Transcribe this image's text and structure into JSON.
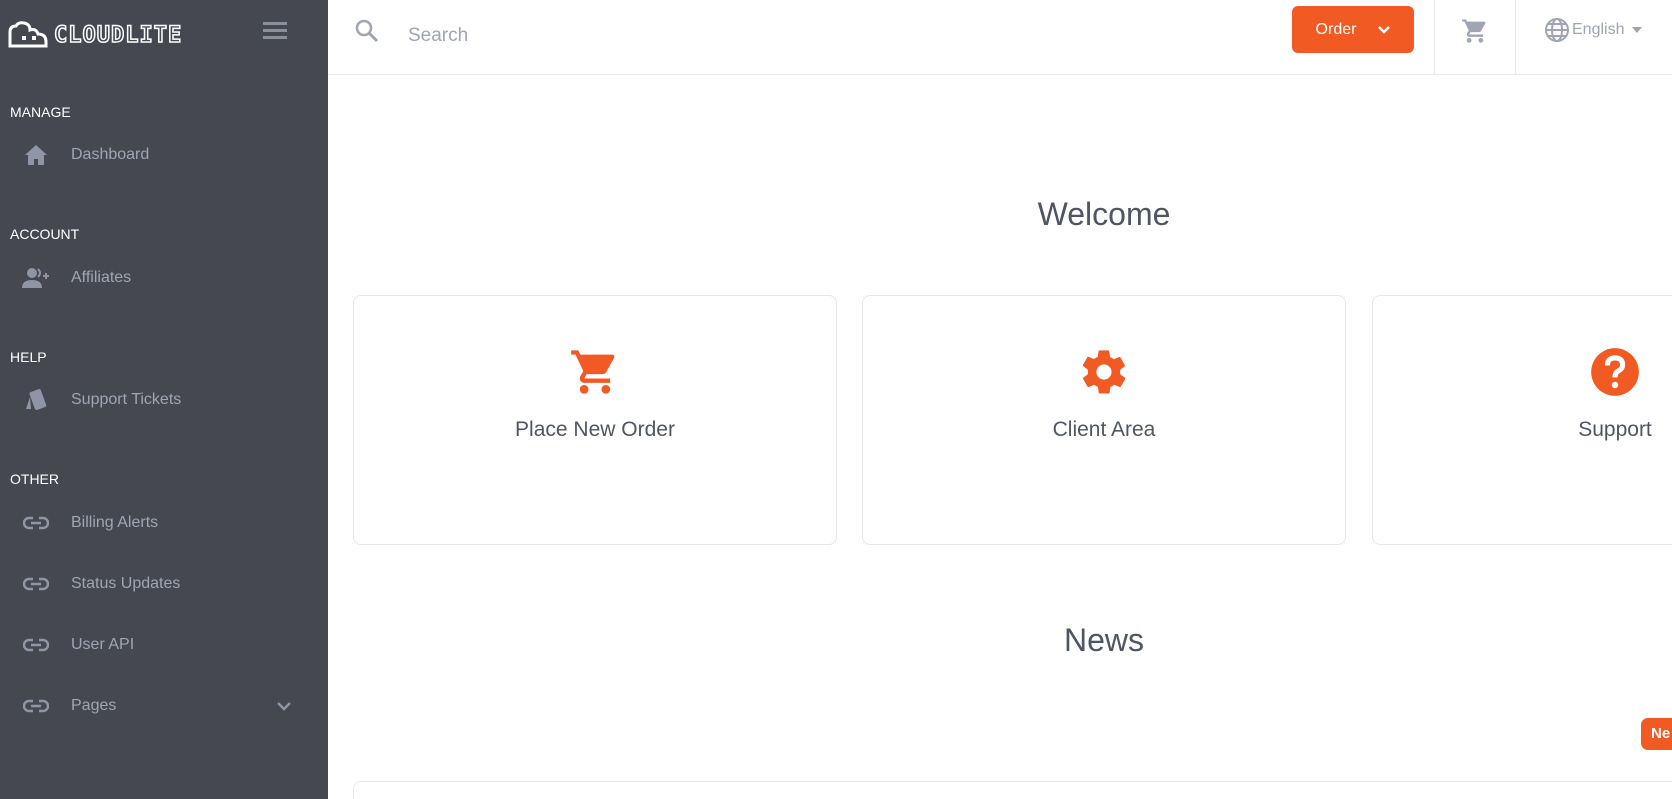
{
  "brand": {
    "name": "CLOUDLITE"
  },
  "sidebar": {
    "sections": [
      {
        "title": "MANAGE",
        "items": [
          {
            "label": "Dashboard",
            "icon": "home-icon"
          }
        ]
      },
      {
        "title": "ACCOUNT",
        "items": [
          {
            "label": "Affiliates",
            "icon": "user-plus-icon"
          }
        ]
      },
      {
        "title": "HELP",
        "items": [
          {
            "label": "Support Tickets",
            "icon": "ticket-icon"
          }
        ]
      },
      {
        "title": "OTHER",
        "items": [
          {
            "label": "Billing Alerts",
            "icon": "link-icon"
          },
          {
            "label": "Status Updates",
            "icon": "link-icon"
          },
          {
            "label": "User API",
            "icon": "link-icon"
          },
          {
            "label": "Pages",
            "icon": "link-icon",
            "expandable": true
          }
        ]
      }
    ]
  },
  "header": {
    "search_placeholder": "Search",
    "order_label": "Order",
    "language": "English"
  },
  "main": {
    "welcome_title": "Welcome",
    "cards": [
      {
        "label": "Place New Order",
        "icon": "cart-icon"
      },
      {
        "label": "Client Area",
        "icon": "gear-icon"
      },
      {
        "label": "Support",
        "icon": "question-circle-icon"
      }
    ],
    "news_title": "News",
    "news_button": "Ne"
  },
  "colors": {
    "accent": "#f25a24",
    "sidebar": "#454851"
  }
}
